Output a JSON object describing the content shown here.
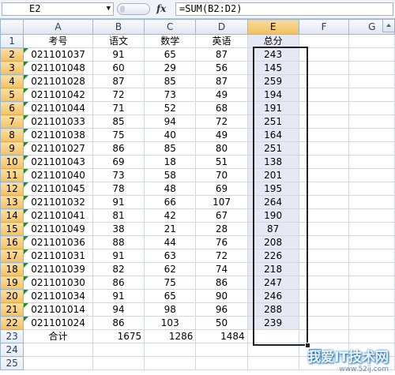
{
  "formula_bar": {
    "name_box": "E2",
    "fx_label": "fx",
    "formula": "=SUM(B2:D2)"
  },
  "columns": [
    "A",
    "B",
    "C",
    "D",
    "E",
    "F",
    "G"
  ],
  "header_row": [
    "考号",
    "语文",
    "数学",
    "英语",
    "总分"
  ],
  "rows": [
    [
      "021101037",
      "91",
      "65",
      "87",
      "243"
    ],
    [
      "021101048",
      "60",
      "29",
      "56",
      "145"
    ],
    [
      "021101028",
      "87",
      "85",
      "87",
      "259"
    ],
    [
      "021101042",
      "72",
      "73",
      "49",
      "194"
    ],
    [
      "021101044",
      "71",
      "52",
      "68",
      "191"
    ],
    [
      "021101033",
      "85",
      "94",
      "72",
      "251"
    ],
    [
      "021101038",
      "75",
      "40",
      "49",
      "164"
    ],
    [
      "021101027",
      "86",
      "85",
      "80",
      "251"
    ],
    [
      "021101043",
      "69",
      "18",
      "51",
      "138"
    ],
    [
      "021101040",
      "73",
      "58",
      "70",
      "201"
    ],
    [
      "021101045",
      "78",
      "48",
      "69",
      "195"
    ],
    [
      "021101032",
      "91",
      "66",
      "107",
      "264"
    ],
    [
      "021101041",
      "81",
      "42",
      "67",
      "190"
    ],
    [
      "021101049",
      "38",
      "21",
      "28",
      "87"
    ],
    [
      "021101036",
      "88",
      "44",
      "76",
      "208"
    ],
    [
      "021101031",
      "91",
      "63",
      "72",
      "226"
    ],
    [
      "021101039",
      "82",
      "62",
      "74",
      "218"
    ],
    [
      "021101030",
      "86",
      "75",
      "86",
      "247"
    ],
    [
      "021101034",
      "91",
      "65",
      "90",
      "246"
    ],
    [
      "021101014",
      "94",
      "98",
      "96",
      "288"
    ],
    [
      "021101024",
      "86",
      "103",
      "50",
      "239"
    ]
  ],
  "total_row": [
    "合计",
    "1675",
    "1286",
    "1484"
  ],
  "row_numbers": [
    "1",
    "2",
    "3",
    "4",
    "5",
    "6",
    "7",
    "8",
    "9",
    "10",
    "11",
    "12",
    "13",
    "14",
    "15",
    "16",
    "17",
    "18",
    "19",
    "20",
    "21",
    "22",
    "23",
    "24",
    "25"
  ],
  "watermark": {
    "text": "我爱IT技术网",
    "sub": "www.52ij.com"
  }
}
